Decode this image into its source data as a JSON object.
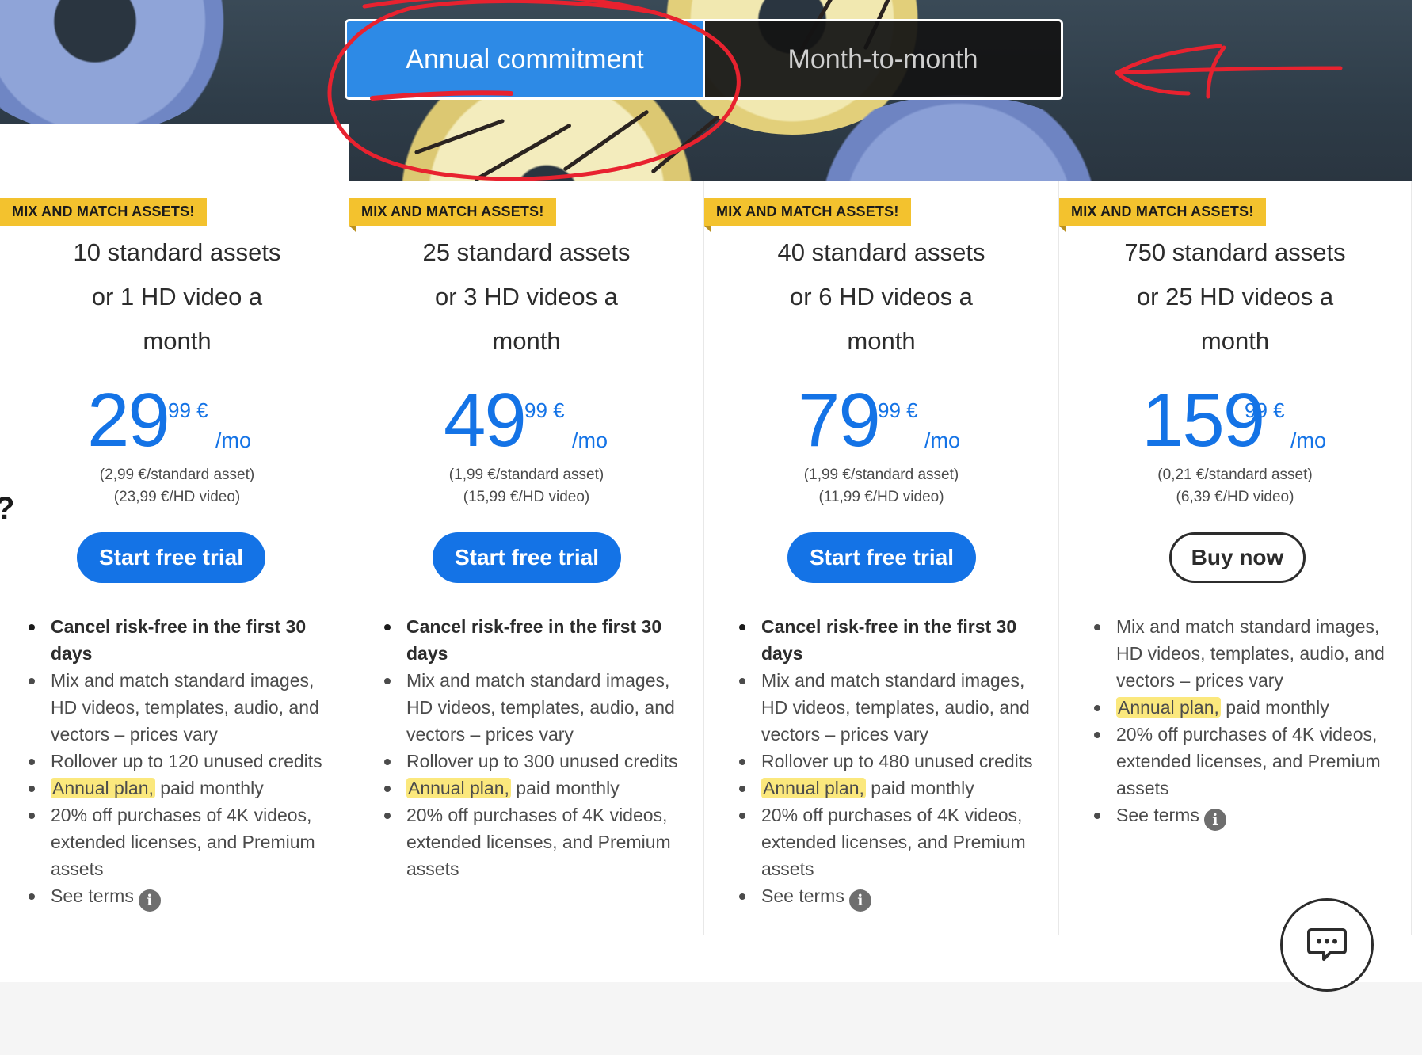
{
  "toggle": {
    "annual_label": "Annual commitment",
    "monthly_label": "Month-to-month"
  },
  "plans": [
    {
      "badge": "MIX AND MATCH ASSETS!",
      "headline": [
        "10 standard assets",
        "or 1 HD video a",
        "month"
      ],
      "price_int": "29",
      "price_dec": "99 €",
      "price_per": "/mo",
      "unit_asset": "(2,99 €/standard asset)",
      "unit_video": "(23,99 €/HD video)",
      "cta": "Start free trial",
      "features": {
        "cancel": "Cancel risk-free in the first 30 days",
        "mix": "Mix and match standard images, HD videos, templates, audio, and vectors – prices vary",
        "rollover": "Rollover up to 120 unused credits",
        "annual_hl": "Annual plan,",
        "annual_rest": " paid monthly",
        "discount": "20% off purchases of 4K videos, extended licenses, and Premium assets",
        "terms": "See terms"
      }
    },
    {
      "badge": "MIX AND MATCH ASSETS!",
      "headline": [
        "25 standard assets",
        "or 3 HD videos a",
        "month"
      ],
      "price_int": "49",
      "price_dec": "99 €",
      "price_per": "/mo",
      "unit_asset": "(1,99 €/standard asset)",
      "unit_video": "(15,99 €/HD video)",
      "cta": "Start free trial",
      "features": {
        "cancel": "Cancel risk-free in the first 30 days",
        "mix": "Mix and match standard images, HD videos, templates, audio, and vectors – prices vary",
        "rollover": "Rollover up to 300 unused credits",
        "annual_hl": "Annual plan,",
        "annual_rest": " paid monthly",
        "discount": "20% off purchases of 4K videos, extended licenses, and Premium assets"
      }
    },
    {
      "badge": "MIX AND MATCH ASSETS!",
      "headline": [
        "40 standard assets",
        "or 6 HD videos a",
        "month"
      ],
      "price_int": "79",
      "price_dec": "99 €",
      "price_per": "/mo",
      "unit_asset": "(1,99 €/standard asset)",
      "unit_video": "(11,99 €/HD video)",
      "cta": "Start free trial",
      "features": {
        "cancel": "Cancel risk-free in the first 30 days",
        "mix": "Mix and match standard images, HD videos, templates, audio, and vectors – prices vary",
        "rollover": "Rollover up to 480 unused credits",
        "annual_hl": "Annual plan,",
        "annual_rest": " paid monthly",
        "discount": "20% off purchases of 4K videos, extended licenses, and Premium assets",
        "terms": "See terms"
      }
    },
    {
      "badge": "MIX AND MATCH ASSETS!",
      "headline": [
        "750 standard assets",
        "or 25 HD videos a",
        "month"
      ],
      "price_int": "159",
      "price_dec": "99 €",
      "price_per": "/mo",
      "unit_asset": "(0,21 €/standard asset)",
      "unit_video": "(6,39 €/HD video)",
      "cta": "Buy now",
      "features": {
        "mix": "Mix and match standard images, HD videos, templates, audio, and vectors – prices vary",
        "annual_hl": "Annual plan,",
        "annual_rest": " paid monthly",
        "discount": "20% off purchases of 4K videos, extended licenses, and Premium assets",
        "terms": "See terms"
      }
    }
  ],
  "icons": {
    "info": "info-icon",
    "chat": "chat-icon"
  },
  "colors": {
    "accent": "#1473e6",
    "badge": "#f3c22e",
    "highlight": "#fbe87d",
    "annotation": "#e8222f"
  }
}
